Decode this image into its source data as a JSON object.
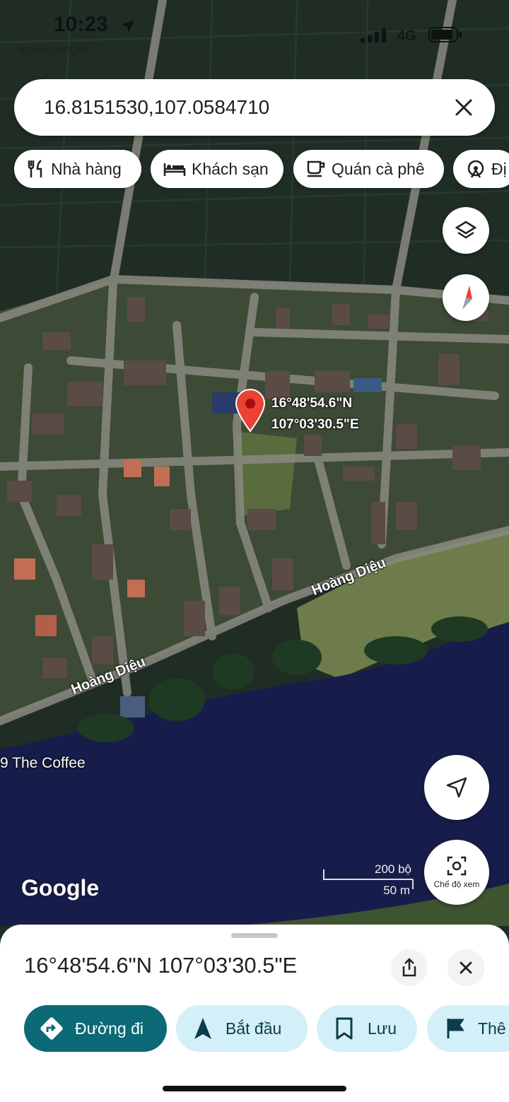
{
  "status_bar": {
    "time": "10:23",
    "back_app": "◀ Messenger",
    "network": "4G"
  },
  "search": {
    "query": "16.8151530,107.0584710"
  },
  "chips": [
    {
      "label": "Nhà hàng",
      "icon": "restaurant-icon"
    },
    {
      "label": "Khách sạn",
      "icon": "hotel-icon"
    },
    {
      "label": "Quán cà phê",
      "icon": "coffee-icon"
    },
    {
      "label": "Đị",
      "icon": "attraction-icon"
    }
  ],
  "pin": {
    "label_lat": "16°48'54.6\"N",
    "label_lng": "107°03'30.5\"E"
  },
  "map_labels": {
    "road_1": "Hoàng Diệu",
    "road_2": "Hoàng Diệu",
    "poi": "9 The Coffee"
  },
  "map_controls": {
    "view_mode_label": "Chế độ xem"
  },
  "attribution": "Google",
  "scale": {
    "imperial": "200 bộ",
    "metric": "50 m"
  },
  "sheet": {
    "coordinates": "16°48'54.6\"N 107°03'30.5\"E",
    "actions": [
      {
        "label": "Đường đi",
        "icon": "directions-icon"
      },
      {
        "label": "Bắt đầu",
        "icon": "navigation-arrow-icon"
      },
      {
        "label": "Lưu",
        "icon": "bookmark-icon"
      },
      {
        "label": "Thê",
        "icon": "flag-icon"
      }
    ]
  },
  "colors": {
    "primary": "#0b6a75",
    "pill_bg": "#d3eff7",
    "pin": "#ea4335",
    "river": "#171d4a"
  }
}
